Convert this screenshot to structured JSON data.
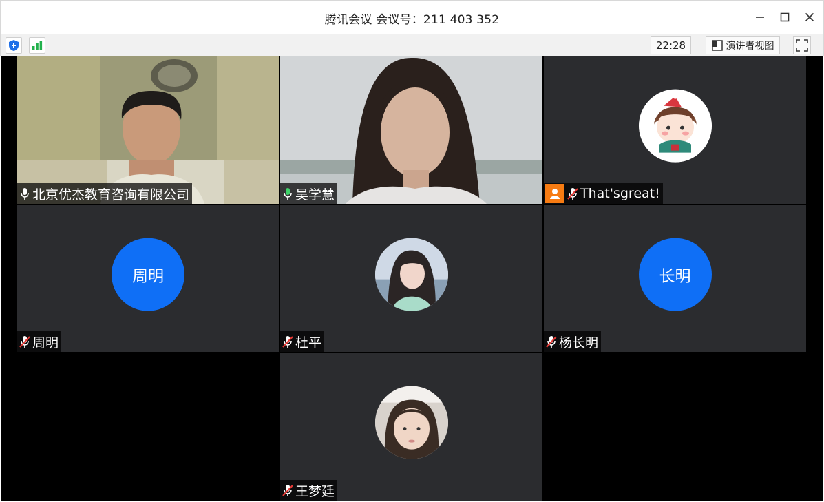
{
  "window": {
    "title": "腾讯会议 会议号：211 403 352",
    "controls": {
      "minimize": "minimize",
      "maximize": "maximize",
      "close": "close"
    }
  },
  "toolbar": {
    "time": "22:28",
    "presenter_view_label": "演讲者视图",
    "icons": [
      "shield-icon",
      "signal-icon",
      "presenter-view-icon",
      "fullscreen-icon"
    ]
  },
  "participants": [
    {
      "name": "北京优杰教育咨询有限公司",
      "mic": "on",
      "type": "video"
    },
    {
      "name": "吴学慧",
      "mic": "speaking",
      "type": "video",
      "active": true
    },
    {
      "name": "That'sgreat!",
      "mic": "muted",
      "type": "photo-avatar",
      "badge": "person-icon"
    },
    {
      "name": "周明",
      "mic": "muted",
      "type": "text-avatar",
      "avatar_text": "周明"
    },
    {
      "name": "杜平",
      "mic": "muted",
      "type": "photo-avatar"
    },
    {
      "name": "杨长明",
      "mic": "muted",
      "type": "text-avatar",
      "avatar_text": "长明"
    },
    {
      "name": "王梦廷",
      "mic": "muted",
      "type": "photo-avatar"
    }
  ],
  "colors": {
    "tile_bg": "#2b2c2f",
    "grid_bg": "#000000",
    "avatar_blue": "#0f6ff6",
    "speaking_green": "#3fae5f",
    "badge_orange": "#f77b12",
    "muted_red": "#e53935"
  }
}
